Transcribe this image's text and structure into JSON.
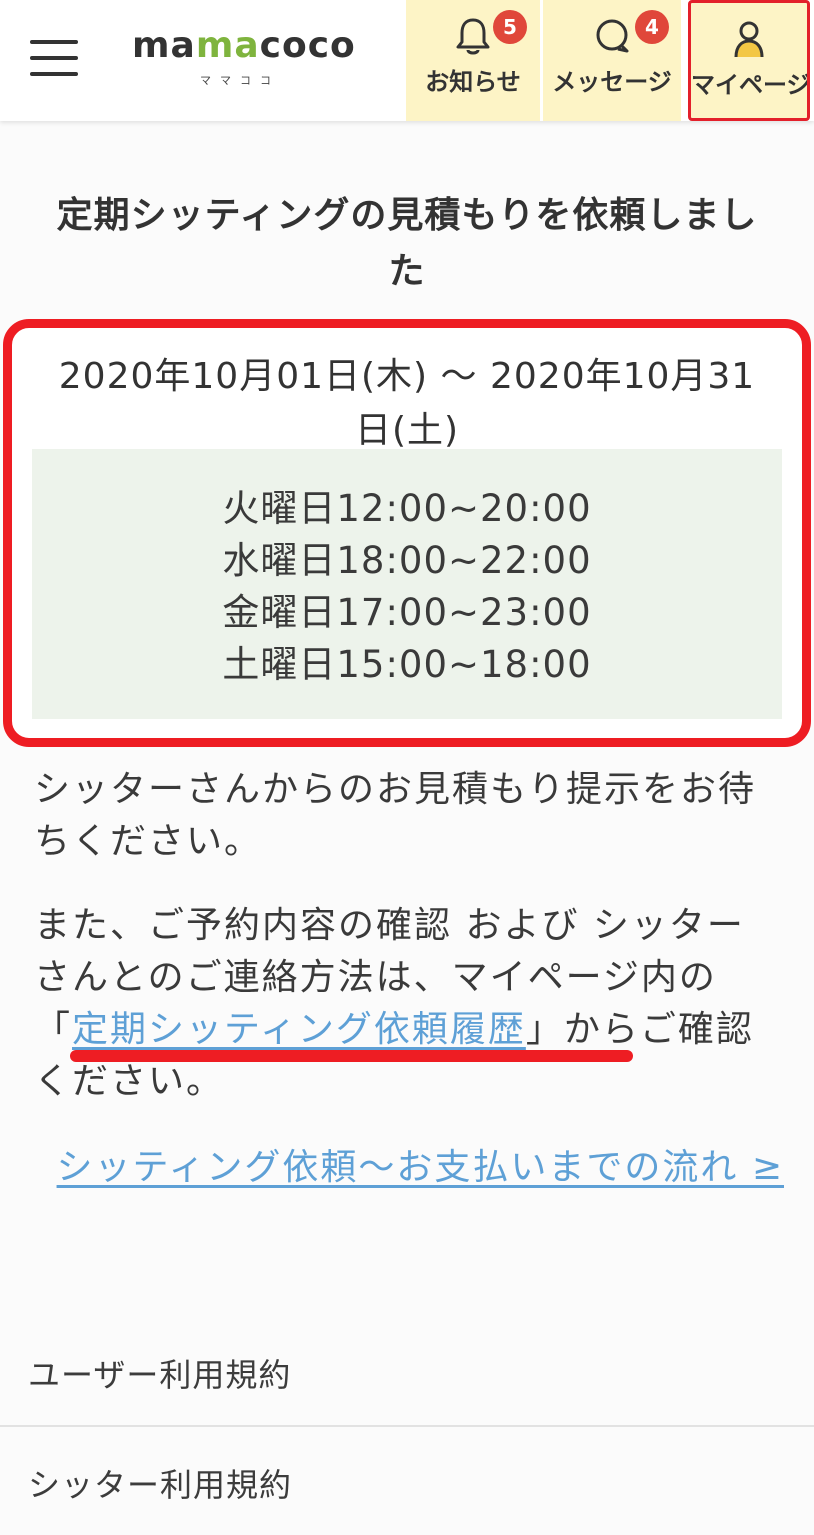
{
  "header": {
    "logo": {
      "main": "mamacoco",
      "sub": "ママココ"
    },
    "nav": {
      "notice": {
        "label": "お知らせ",
        "badge": "5",
        "icon": "bell-icon"
      },
      "message": {
        "label": "メッセージ",
        "badge": "4",
        "icon": "chat-bubble-icon"
      },
      "mypage": {
        "label": "マイページ",
        "icon": "user-icon"
      }
    },
    "colors": {
      "nav_background": "#fdf4c6",
      "badge": "#e0473a",
      "highlight": "#ee1d23",
      "logo_accent": "#7fb43e"
    }
  },
  "main": {
    "title_line1": "定期シッティングの見積もりを依頼しまし",
    "title_line2": "た",
    "date_range_line1": "2020年10月01日(木) 〜 2020年10月31",
    "date_range_line2": "日(土)",
    "schedule": [
      "火曜日12:00~20:00",
      "水曜日18:00~22:00",
      "金曜日17:00~23:00",
      "土曜日15:00~18:00"
    ],
    "paragraph1": "シッターさんからのお見積もり提示をお待ちください。",
    "paragraph2_before": "また、ご予約内容の確認 および シッターさんとのご連絡方法は、マイページ内の「",
    "paragraph2_link": "定期シッティング依頼履歴",
    "paragraph2_after": "」からご確認ください。",
    "flow_link": "シッティング依頼〜お支払いまでの流れ ≥"
  },
  "footer": {
    "items": [
      "ユーザー利用規約",
      "シッター利用規約"
    ]
  }
}
